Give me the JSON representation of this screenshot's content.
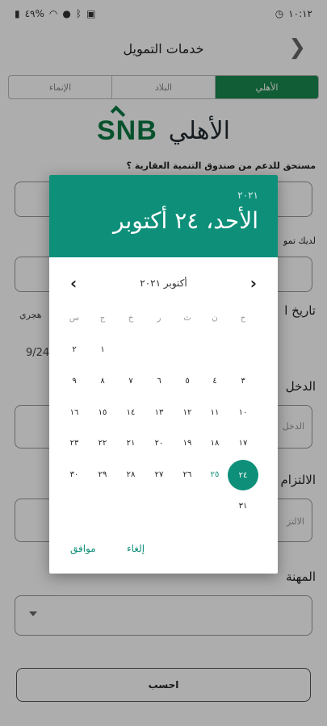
{
  "status_bar": {
    "time": "١٠:١٢",
    "battery": "٤٩%"
  },
  "header": {
    "title": "خدمات التمويل"
  },
  "tabs": [
    {
      "label": "الأهلي",
      "active": true
    },
    {
      "label": "البلاد",
      "active": false
    },
    {
      "label": "الإنماء",
      "active": false
    }
  ],
  "logo": {
    "latin": "SNB",
    "arabic": "الأهلي"
  },
  "form": {
    "question1": "مستحق للدعم من صندوق التنمية العقارية ؟",
    "label2": "لديك تمو",
    "label3": "تاريخ ا",
    "label3b": "هجري",
    "date_value": "9/24",
    "label4": "الدخل",
    "placeholder4": "الدخل",
    "label5": "الالتزام",
    "placeholder5": "الالتز",
    "label6": "المهنة",
    "calculate": "احسب"
  },
  "date_picker": {
    "year": "٢٠٢١",
    "selected_date": "الأحد، ٢٤ أكتوبر",
    "month_label": "أكتوبر ٢٠٢١",
    "weekdays": [
      "ح",
      "ن",
      "ث",
      "ر",
      "خ",
      "ج",
      "س"
    ],
    "rows": [
      [
        "",
        "",
        "",
        "",
        "",
        "١",
        "٢"
      ],
      [
        "٣",
        "٤",
        "٥",
        "٦",
        "٧",
        "٨",
        "٩"
      ],
      [
        "١٠",
        "١١",
        "١٢",
        "١٣",
        "١٤",
        "١٥",
        "١٦"
      ],
      [
        "١٧",
        "١٨",
        "١٩",
        "٢٠",
        "٢١",
        "٢٢",
        "٢٣"
      ],
      [
        "٢٤",
        "٢٥",
        "٢٦",
        "٢٧",
        "٢٨",
        "٢٩",
        "٣٠"
      ],
      [
        "٣١",
        "",
        "",
        "",
        "",
        "",
        ""
      ]
    ],
    "selected_day": "٢٤",
    "today_day": "٢٥",
    "cancel": "إلغاء",
    "ok": "موافق"
  },
  "colors": {
    "accent": "#0e8f7a",
    "tab_active": "#1a8a4e",
    "snb_green": "#0b7a43"
  }
}
